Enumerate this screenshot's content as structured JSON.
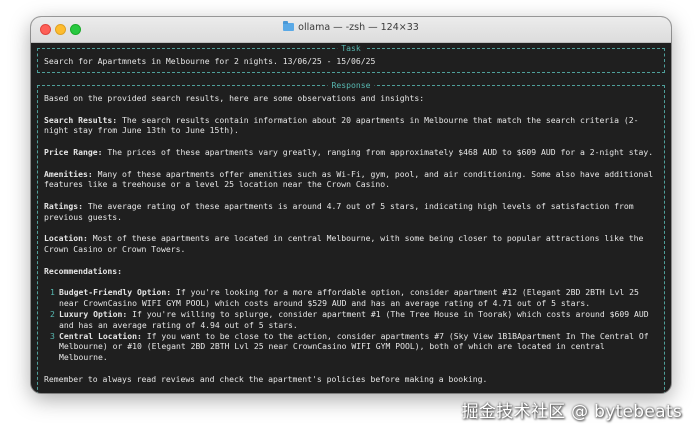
{
  "window": {
    "title": "ollama — -zsh — 124×33"
  },
  "task": {
    "label": "Task",
    "text": "Search for Apartmnets in Melbourne for 2 nights. 13/06/25 - 15/06/25"
  },
  "response": {
    "label": "Response",
    "intro": "Based on the provided search results, here are some observations and insights:",
    "sections": [
      {
        "heading": "Search Results:",
        "text": " The search results contain information about 20 apartments in Melbourne that match the search criteria (2-night stay from June 13th to June 15th)."
      },
      {
        "heading": "Price Range:",
        "text": " The prices of these apartments vary greatly, ranging from approximately $468 AUD to $609 AUD for a 2-night stay."
      },
      {
        "heading": "Amenities:",
        "text": " Many of these apartments offer amenities such as Wi-Fi, gym, pool, and air conditioning. Some also have additional features like a treehouse or a level 25 location near the Crown Casino."
      },
      {
        "heading": "Ratings:",
        "text": " The average rating of these apartments is around 4.7 out of 5 stars, indicating high levels of satisfaction from previous guests."
      },
      {
        "heading": "Location:",
        "text": " Most of these apartments are located in central Melbourne, with some being closer to popular attractions like the Crown Casino or Crown Towers."
      }
    ],
    "recommendations_heading": "Recommendations:",
    "recommendations": [
      {
        "num": "1",
        "heading": "Budget-Friendly Option:",
        "text": " If you're looking for a more affordable option, consider apartment #12 (Elegant 2BD 2BTH Lvl 25 near CrownCasino WIFI GYM POOL) which costs around $529 AUD and has an average rating of 4.71 out of 5 stars."
      },
      {
        "num": "2",
        "heading": "Luxury Option:",
        "text": " If you're willing to splurge, consider apartment #1 (The Tree House in Toorak) which costs around $609 AUD and has an average rating of 4.94 out of 5 stars."
      },
      {
        "num": "3",
        "heading": "Central Location:",
        "text": " If you want to be close to the action, consider apartments #7 (Sky View 1B1BApartment In The Central Of Melbourne) or #10 (Elegant 2BD 2BTH Lvl 25 near CrownCasino WIFI GYM POOL), both of which are located in central Melbourne."
      }
    ],
    "closing": "Remember to always read reviews and check the apartment's policies before making a booking."
  },
  "watermark": "掘金技术社区 @ bytebeats",
  "colors": {
    "terminal_bg": "#1f1f1f",
    "accent": "#57b8b1",
    "text": "#e6e6e6"
  }
}
